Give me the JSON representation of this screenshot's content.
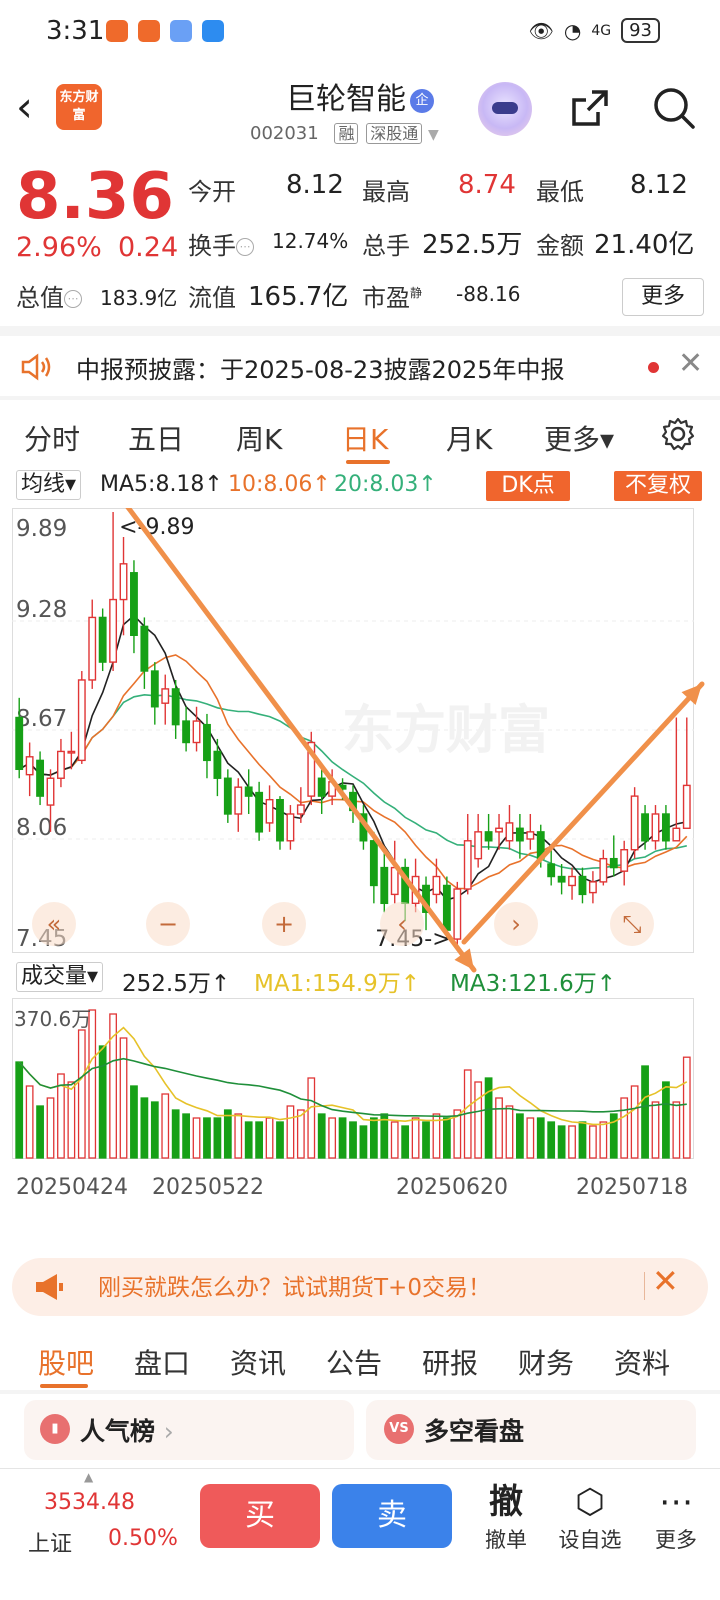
{
  "status_bar": {
    "time": "3:31",
    "battery": "93",
    "network": "4G"
  },
  "header": {
    "logo_text": "东方财富",
    "stock_name": "巨轮智能",
    "name_badge": "企",
    "stock_code": "002031",
    "tags": [
      "融",
      "深股通"
    ]
  },
  "quote": {
    "price": "8.36",
    "change_pct": "2.96%",
    "change_amt": "0.24",
    "open_label": "今开",
    "open": "8.12",
    "high_label": "最高",
    "high": "8.74",
    "low_label": "最低",
    "low": "8.12",
    "turnover_label": "换手",
    "turnover": "12.74%",
    "volume_label": "总手",
    "volume": "252.5万",
    "amount_label": "金额",
    "amount": "21.40亿",
    "mktcap_label": "总值",
    "mktcap": "183.9亿",
    "float_label": "流值",
    "float_cap": "165.7亿",
    "pe_label": "市盈",
    "pe_sup": "静",
    "pe": "-88.16",
    "more_label": "更多"
  },
  "notice": {
    "text": "中报预披露：于2025-08-23披露2025年中报"
  },
  "chart_tabs": [
    "分时",
    "五日",
    "周K",
    "日K",
    "月K",
    "更多▾"
  ],
  "ma": {
    "selector": "均线▾",
    "ma5": "MA5:8.18↑",
    "ma10": "10:8.06↑",
    "ma20": "20:8.03↑",
    "dk_label": "DK点",
    "fq_label": "不复权"
  },
  "volume_row": {
    "selector": "成交量▾",
    "vol": "252.5万↑",
    "ma1": "MA1:154.9万↑",
    "ma3": "MA3:121.6万↑"
  },
  "chart_data": {
    "type": "candlestick",
    "y_ticks": [
      "9.89",
      "9.28",
      "8.67",
      "8.06",
      "7.45"
    ],
    "ylim": [
      7.45,
      9.89
    ],
    "vol_tick": "370.6万",
    "x_labels": [
      "20250424",
      "20250522",
      "20250620",
      "20250718"
    ],
    "high_mark": "<-9.89",
    "low_mark": "7.45->",
    "watermark": "东方财富",
    "colors": {
      "up": "#e03535",
      "down": "#16a016",
      "ma5": "#222222",
      "ma10": "#e8722b",
      "ma20": "#35b07a",
      "vol_ma1": "#e6c229",
      "vol_ma3": "#1f8f3a",
      "arrow": "#f0904a"
    },
    "candles": [
      [
        8.74,
        8.45,
        8.85,
        8.4
      ],
      [
        8.42,
        8.52,
        8.6,
        8.3
      ],
      [
        8.5,
        8.3,
        8.55,
        8.25
      ],
      [
        8.25,
        8.4,
        8.45,
        8.1
      ],
      [
        8.4,
        8.55,
        8.62,
        8.35
      ],
      [
        8.55,
        8.55,
        8.66,
        8.45
      ],
      [
        8.5,
        8.95,
        9.0,
        8.48
      ],
      [
        8.95,
        9.3,
        9.4,
        8.9
      ],
      [
        9.3,
        9.05,
        9.35,
        9.0
      ],
      [
        9.05,
        9.4,
        9.89,
        9.0
      ],
      [
        9.4,
        9.6,
        9.75,
        9.2
      ],
      [
        9.55,
        9.2,
        9.62,
        9.1
      ],
      [
        9.25,
        9.0,
        9.3,
        8.9
      ],
      [
        9.0,
        8.8,
        9.05,
        8.7
      ],
      [
        8.82,
        8.9,
        8.98,
        8.7
      ],
      [
        8.9,
        8.7,
        8.95,
        8.62
      ],
      [
        8.72,
        8.6,
        8.8,
        8.55
      ],
      [
        8.6,
        8.72,
        8.8,
        8.55
      ],
      [
        8.7,
        8.5,
        8.76,
        8.4
      ],
      [
        8.55,
        8.4,
        8.62,
        8.3
      ],
      [
        8.4,
        8.2,
        8.45,
        8.15
      ],
      [
        8.2,
        8.35,
        8.4,
        8.1
      ],
      [
        8.35,
        8.3,
        8.45,
        8.2
      ],
      [
        8.32,
        8.1,
        8.38,
        8.05
      ],
      [
        8.15,
        8.28,
        8.36,
        8.1
      ],
      [
        8.28,
        8.05,
        8.3,
        8.0
      ],
      [
        8.05,
        8.2,
        8.25,
        8.0
      ],
      [
        8.2,
        8.25,
        8.35,
        8.15
      ],
      [
        8.3,
        8.6,
        8.66,
        8.25
      ],
      [
        8.4,
        8.3,
        8.45,
        8.2
      ],
      [
        8.3,
        8.38,
        8.45,
        8.25
      ],
      [
        8.36,
        8.34,
        8.4,
        8.28
      ],
      [
        8.32,
        8.22,
        8.36,
        8.15
      ],
      [
        8.2,
        8.05,
        8.25,
        8.0
      ],
      [
        8.05,
        7.8,
        8.1,
        7.7
      ],
      [
        7.9,
        7.7,
        8.0,
        7.65
      ],
      [
        7.75,
        7.9,
        8.05,
        7.7
      ],
      [
        7.9,
        7.7,
        7.95,
        7.6
      ],
      [
        7.7,
        7.85,
        7.95,
        7.65
      ],
      [
        7.8,
        7.65,
        7.85,
        7.55
      ],
      [
        7.75,
        7.85,
        7.95,
        7.7
      ],
      [
        7.8,
        7.55,
        7.85,
        7.5
      ],
      [
        7.5,
        7.78,
        7.82,
        7.45
      ],
      [
        7.78,
        8.05,
        8.2,
        7.75
      ],
      [
        7.95,
        8.1,
        8.2,
        7.9
      ],
      [
        8.1,
        8.05,
        8.2,
        8.0
      ],
      [
        8.1,
        8.12,
        8.2,
        8.0
      ],
      [
        8.05,
        8.15,
        8.25,
        8.0
      ],
      [
        8.12,
        8.05,
        8.2,
        7.95
      ],
      [
        8.06,
        8.1,
        8.2,
        8.0
      ],
      [
        8.1,
        7.95,
        8.14,
        7.9
      ],
      [
        7.92,
        7.85,
        8.0,
        7.8
      ],
      [
        7.85,
        7.82,
        7.92,
        7.75
      ],
      [
        7.8,
        7.85,
        7.9,
        7.72
      ],
      [
        7.85,
        7.75,
        7.9,
        7.7
      ],
      [
        7.76,
        7.82,
        7.88,
        7.7
      ],
      [
        7.82,
        7.95,
        8.0,
        7.8
      ],
      [
        7.95,
        7.9,
        8.08,
        7.85
      ],
      [
        7.88,
        8.0,
        8.05,
        7.8
      ],
      [
        8.0,
        8.3,
        8.35,
        7.95
      ],
      [
        8.2,
        8.05,
        8.25,
        8.0
      ],
      [
        8.05,
        8.2,
        8.25,
        8.0
      ],
      [
        8.2,
        8.05,
        8.25,
        8.0
      ],
      [
        8.05,
        8.12,
        8.74,
        8.12
      ],
      [
        8.12,
        8.36,
        8.74,
        8.12
      ]
    ],
    "volumes": [
      240,
      180,
      130,
      150,
      210,
      190,
      320,
      370,
      280,
      360,
      300,
      180,
      150,
      140,
      160,
      120,
      110,
      100,
      100,
      100,
      120,
      110,
      90,
      90,
      100,
      90,
      130,
      120,
      200,
      110,
      100,
      100,
      90,
      80,
      100,
      110,
      90,
      80,
      100,
      90,
      110,
      100,
      120,
      220,
      190,
      200,
      150,
      130,
      110,
      100,
      100,
      90,
      80,
      80,
      90,
      80,
      90,
      110,
      150,
      180,
      230,
      140,
      190,
      140,
      252
    ]
  },
  "ad": {
    "text": "刚买就跌怎么办？试试期货T+0交易！"
  },
  "bottom_tabs": [
    "股吧",
    "盘口",
    "资讯",
    "公告",
    "研报",
    "财务",
    "资料"
  ],
  "cards": {
    "left": "人气榜",
    "left_chev": "›",
    "right_icon": "VS",
    "right": "多空看盘"
  },
  "footer": {
    "index_value": "3534.48",
    "index_name": "上证",
    "index_change": "0.50%",
    "buy": "买",
    "sell": "卖",
    "cancel_icon": "撤",
    "cancel": "撤单",
    "watch": "设自选",
    "more": "更多"
  }
}
